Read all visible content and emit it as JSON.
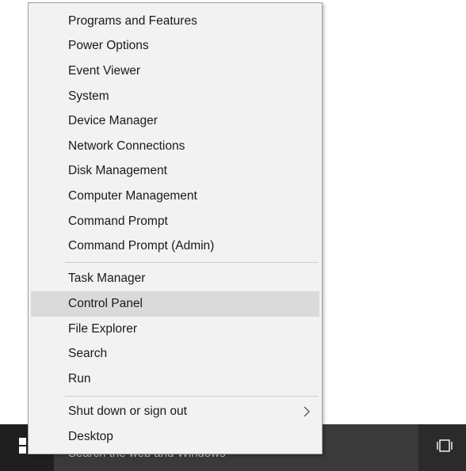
{
  "menu": {
    "group1": [
      {
        "label": "Programs and Features"
      },
      {
        "label": "Power Options"
      },
      {
        "label": "Event Viewer"
      },
      {
        "label": "System"
      },
      {
        "label": "Device Manager"
      },
      {
        "label": "Network Connections"
      },
      {
        "label": "Disk Management"
      },
      {
        "label": "Computer Management"
      },
      {
        "label": "Command Prompt"
      },
      {
        "label": "Command Prompt (Admin)"
      }
    ],
    "group2": [
      {
        "label": "Task Manager"
      },
      {
        "label": "Control Panel",
        "highlighted": true
      },
      {
        "label": "File Explorer"
      },
      {
        "label": "Search"
      },
      {
        "label": "Run"
      }
    ],
    "group3": [
      {
        "label": "Shut down or sign out",
        "icon": "chevron-right-icon"
      },
      {
        "label": "Desktop"
      }
    ]
  },
  "taskbar": {
    "start_icon": "windows-logo-icon",
    "search_placeholder": "Search the web and Windows",
    "taskview_icon": "task-view-icon"
  },
  "colors": {
    "menu_background": "#f2f2f2",
    "highlight": "#dadada",
    "taskbar": "#2b2b2b",
    "text": "#1a1a1a"
  }
}
